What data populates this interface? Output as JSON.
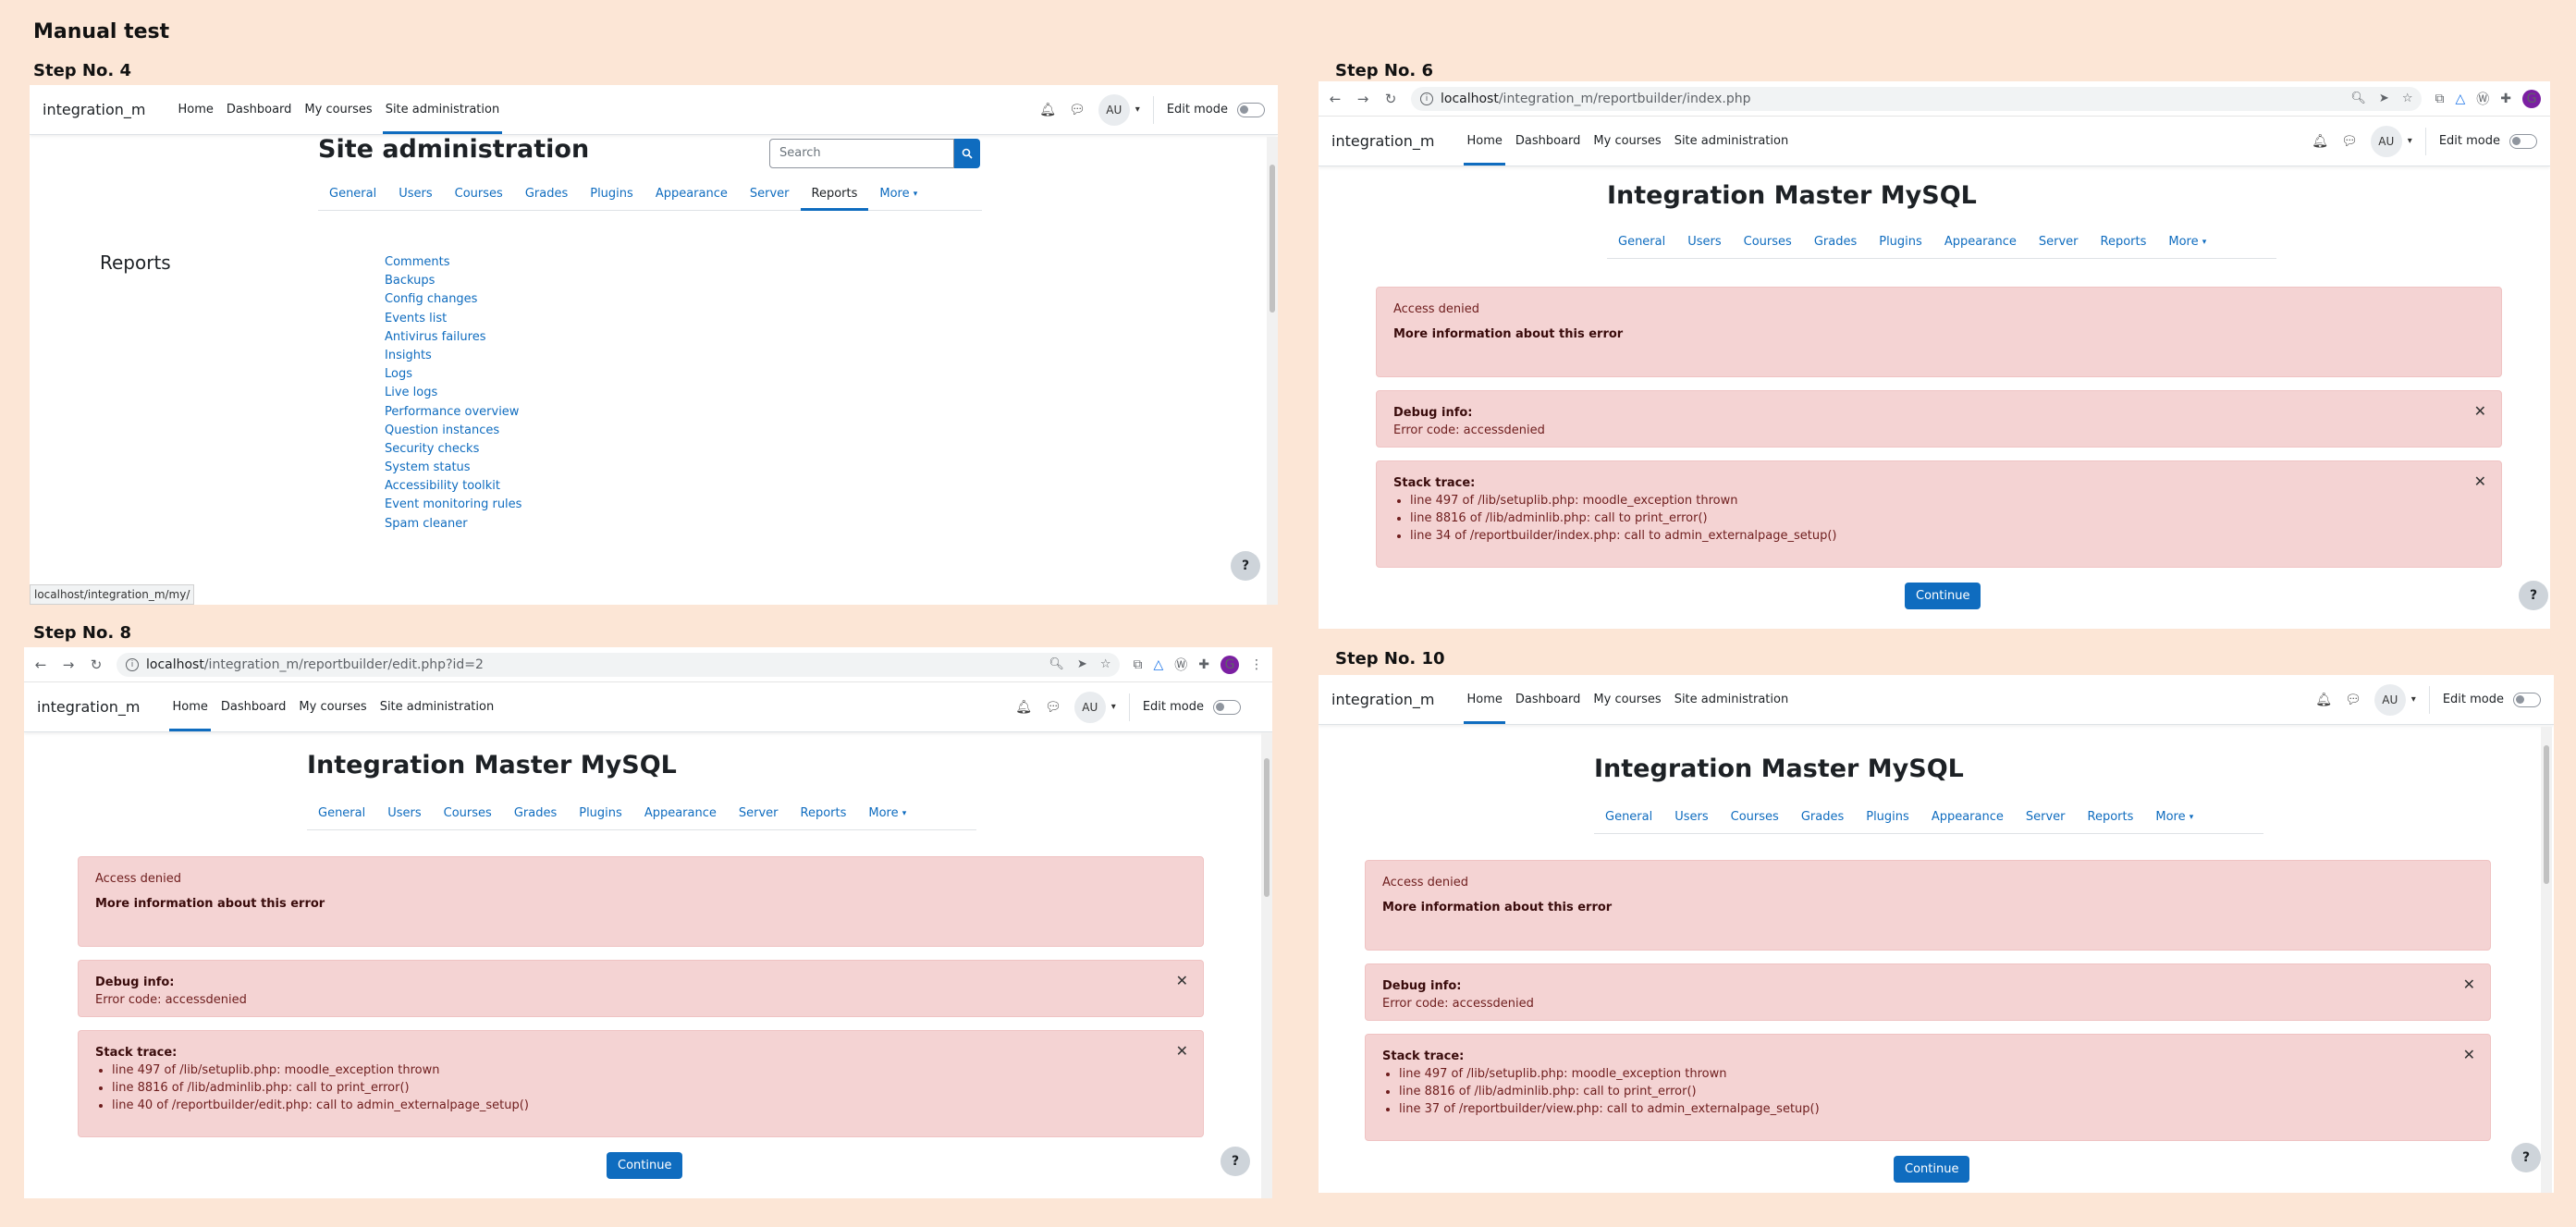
{
  "doc_title": "Manual test",
  "common": {
    "brand": "integration_m",
    "nav": [
      "Home",
      "Dashboard",
      "My courses",
      "Site administration"
    ],
    "avatar": "AU",
    "edit_mode": "Edit mode",
    "sec_nav": [
      "General",
      "Users",
      "Courses",
      "Grades",
      "Plugins",
      "Appearance",
      "Server",
      "Reports",
      "More"
    ],
    "site_name": "Integration Master MySQL",
    "access_denied": "Access denied",
    "more_info": "More information about this error",
    "debug_title": "Debug info:",
    "debug_code": "Error code: accessdenied",
    "stack_title": "Stack trace:",
    "trace_1": "line 497 of /lib/setuplib.php: moodle_exception thrown",
    "trace_2": "line 8816 of /lib/adminlib.php: call to print_error()",
    "continue": "Continue",
    "help": "?"
  },
  "step4": {
    "label": "Step No. 4",
    "heading": "Site administration",
    "search_placeholder": "Search",
    "section_title": "Reports",
    "links": [
      "Comments",
      "Backups",
      "Config changes",
      "Events list",
      "Antivirus failures",
      "Insights",
      "Logs",
      "Live logs",
      "Performance overview",
      "Question instances",
      "Security checks",
      "System status",
      "Accessibility toolkit",
      "Event monitoring rules",
      "Spam cleaner"
    ],
    "status_url": "localhost/integration_m/my/"
  },
  "step6": {
    "label": "Step No. 6",
    "url_host": "localhost",
    "url_path": "/integration_m/reportbuilder/index.php",
    "trace_3": "line 34 of /reportbuilder/index.php: call to admin_externalpage_setup()"
  },
  "step8": {
    "label": "Step No. 8",
    "url_host": "localhost",
    "url_path": "/integration_m/reportbuilder/edit.php?id=2",
    "trace_3": "line 40 of /reportbuilder/edit.php: call to admin_externalpage_setup()"
  },
  "step10": {
    "label": "Step No. 10",
    "trace_3": "line 37 of /reportbuilder/view.php: call to admin_externalpage_setup()"
  }
}
